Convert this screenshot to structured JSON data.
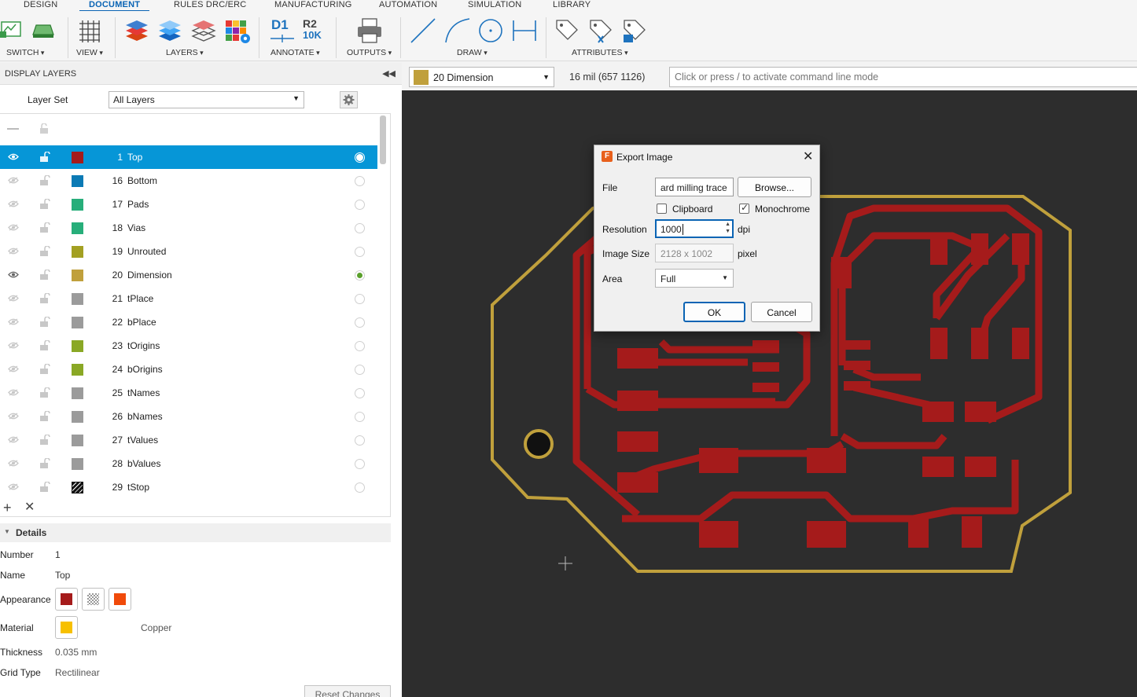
{
  "ribbon": {
    "tabs": [
      "DESIGN",
      "DOCUMENT",
      "RULES DRC/ERC",
      "MANUFACTURING",
      "AUTOMATION",
      "SIMULATION",
      "LIBRARY"
    ],
    "active_tab": "DOCUMENT",
    "groups": [
      "SWITCH",
      "VIEW",
      "LAYERS",
      "ANNOTATE",
      "OUTPUTS",
      "DRAW",
      "ATTRIBUTES"
    ],
    "annotate_icons": {
      "d1": "D1",
      "r2": "R2",
      "r2_value": "10K"
    }
  },
  "panel": {
    "title": "DISPLAY LAYERS",
    "layer_set_label": "Layer Set",
    "layer_set_value": "All Layers",
    "layers": [
      {
        "num": "1",
        "name": "Top",
        "color": "#a51b1b",
        "visible": true,
        "selected": true
      },
      {
        "num": "16",
        "name": "Bottom",
        "color": "#0b7ab5",
        "visible": false
      },
      {
        "num": "17",
        "name": "Pads",
        "color": "#27ae7a",
        "visible": false
      },
      {
        "num": "18",
        "name": "Vias",
        "color": "#27ae7a",
        "visible": false
      },
      {
        "num": "19",
        "name": "Unrouted",
        "color": "#a3a022",
        "visible": false
      },
      {
        "num": "20",
        "name": "Dimension",
        "color": "#c0a03c",
        "visible": true,
        "current": true
      },
      {
        "num": "21",
        "name": "tPlace",
        "color": "#9b9b9b",
        "visible": false
      },
      {
        "num": "22",
        "name": "bPlace",
        "color": "#9b9b9b",
        "visible": false
      },
      {
        "num": "23",
        "name": "tOrigins",
        "color": "#8aa825",
        "visible": false
      },
      {
        "num": "24",
        "name": "bOrigins",
        "color": "#8aa825",
        "visible": false
      },
      {
        "num": "25",
        "name": "tNames",
        "color": "#9b9b9b",
        "visible": false
      },
      {
        "num": "26",
        "name": "bNames",
        "color": "#9b9b9b",
        "visible": false
      },
      {
        "num": "27",
        "name": "tValues",
        "color": "#9b9b9b",
        "visible": false
      },
      {
        "num": "28",
        "name": "bValues",
        "color": "#9b9b9b",
        "visible": false
      },
      {
        "num": "29",
        "name": "tStop",
        "color": "#111111",
        "visible": false,
        "hatched": true
      }
    ],
    "details": {
      "title": "Details",
      "number_label": "Number",
      "number": "1",
      "name_label": "Name",
      "name": "Top",
      "appearance_label": "Appearance",
      "material_label": "Material",
      "material": "Copper",
      "thickness_label": "Thickness",
      "thickness": "0.035 mm",
      "grid_label": "Grid Type",
      "grid": "Rectilinear",
      "reset_label": "Reset Changes"
    }
  },
  "cmdbar": {
    "current_layer": "20 Dimension",
    "coords": "16 mil (657 1126)",
    "placeholder": "Click or press / to activate command line mode"
  },
  "dialog": {
    "title": "Export Image",
    "file_label": "File",
    "file_value": "ard milling trace",
    "browse_label": "Browse...",
    "clipboard_label": "Clipboard",
    "clipboard_checked": false,
    "monochrome_label": "Monochrome",
    "monochrome_checked": true,
    "resolution_label": "Resolution",
    "resolution_value": "1000",
    "resolution_unit": "dpi",
    "size_label": "Image Size",
    "size_value": "2128 x 1002",
    "size_unit": "pixel",
    "area_label": "Area",
    "area_value": "Full",
    "ok_label": "OK",
    "cancel_label": "Cancel"
  },
  "colors": {
    "accent": "#0696d7",
    "copper": "#a51b1b",
    "dimension": "#c0a03c",
    "canvas": "#2d2d2d"
  }
}
